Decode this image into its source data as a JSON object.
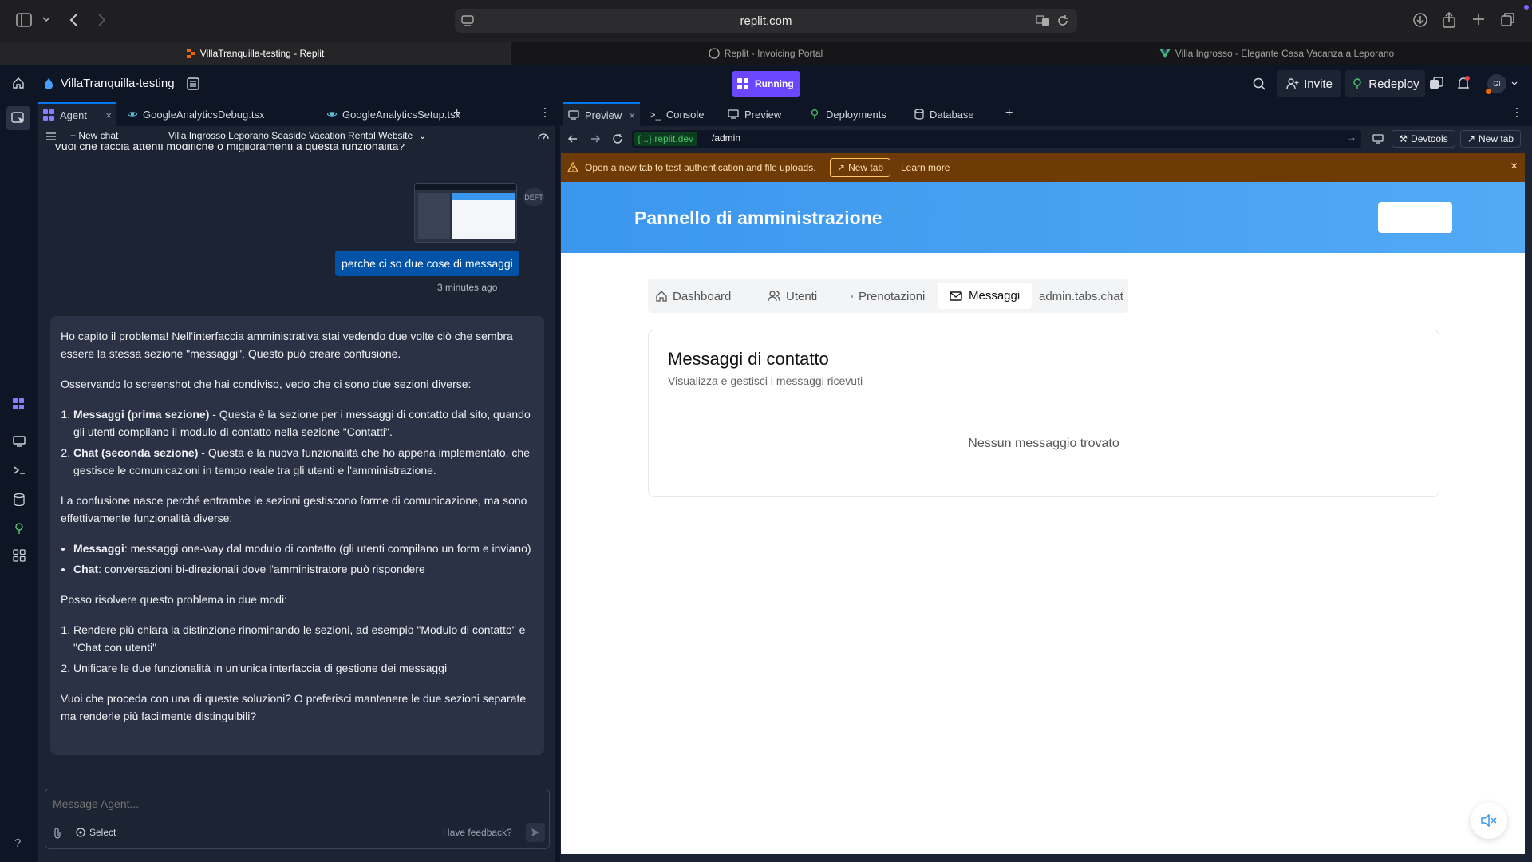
{
  "browser": {
    "url": "replit.com",
    "tabs": [
      {
        "label": "VillaTranquilla-testing - Replit",
        "active": true
      },
      {
        "label": "Replit - Invoicing Portal",
        "active": false
      },
      {
        "label": "Villa Ingrosso - Elegante Casa Vacanza a Leporano",
        "active": false
      }
    ]
  },
  "header": {
    "project_name": "VillaTranquilla-testing",
    "run_status": "Running",
    "invite_label": "Invite",
    "redeploy_label": "Redeploy",
    "avatar_initials": "GI"
  },
  "agent_panel": {
    "tabs": [
      "Agent",
      "GoogleAnalyticsDebug.tsx",
      "GoogleAnalyticsSetup.tsx"
    ],
    "new_chat_label": "New chat",
    "chat_title": "Villa Ingrosso Leporano Seaside Vacation Rental Website",
    "truncated_line": "Vuoi che faccia attenti modifiche o miglioramenti a questa funzionalità?",
    "user_badge": "DEFT",
    "user_message": "perche ci so due cose di messaggi",
    "user_time": "3 minutes ago",
    "agent_message": {
      "p1": "Ho capito il problema! Nell'interfaccia amministrativa stai vedendo due volte ciò che sembra essere la stessa sezione \"messaggi\". Questo può creare confusione.",
      "p2": "Osservando lo screenshot che hai condiviso, vedo che ci sono due sezioni diverse:",
      "list1": [
        {
          "bold": "Messaggi (prima sezione)",
          "text": " - Questa è la sezione per i messaggi di contatto dal sito, quando gli utenti compilano il modulo di contatto nella sezione \"Contatti\"."
        },
        {
          "bold": "Chat (seconda sezione)",
          "text": " - Questa è la nuova funzionalità che ho appena implementato, che gestisce le comunicazioni in tempo reale tra gli utenti e l'amministrazione."
        }
      ],
      "p3": "La confusione nasce perché entrambe le sezioni gestiscono forme di comunicazione, ma sono effettivamente funzionalità diverse:",
      "list2": [
        {
          "bold": "Messaggi",
          "text": ": messaggi one-way dal modulo di contatto (gli utenti compilano un form e inviano)"
        },
        {
          "bold": "Chat",
          "text": ": conversazioni bi-direzionali dove l'amministratore può rispondere"
        }
      ],
      "p4": "Posso risolvere questo problema in due modi:",
      "list3": [
        "Rendere più chiara la distinzione rinominando le sezioni, ad esempio \"Modulo di contatto\" e \"Chat con utenti\"",
        "Unificare le due funzionalità in un'unica interfaccia di gestione dei messaggi"
      ],
      "p5": "Vuoi che proceda con una di queste soluzioni? O preferisci mantenere le due sezioni separate ma renderle più facilmente distinguibili?"
    },
    "composer_placeholder": "Message Agent...",
    "select_label": "Select",
    "feedback_label": "Have feedback?"
  },
  "preview_panel": {
    "tabs": [
      "Preview",
      "Console",
      "Preview",
      "Deployments",
      "Database"
    ],
    "domain": "{...}.replit.dev",
    "path": "/admin",
    "devtools_label": "Devtools",
    "new_tab_label": "New tab",
    "warning_text": "Open a new tab to test authentication and file uploads.",
    "warning_button": "New tab",
    "warning_link": "Learn more"
  },
  "site": {
    "header_title": "Pannello di amministrazione",
    "tabs": [
      "Dashboard",
      "Utenti",
      "Prenotazioni",
      "Messaggi",
      "admin.tabs.chat"
    ],
    "active_tab": "Messaggi",
    "card_title": "Messaggi di contatto",
    "card_subtitle": "Visualizza e gestisci i messaggi ricevuti",
    "empty_text": "Nessun messaggio trovato"
  },
  "colors": {
    "replit_bg": "#0e1525",
    "panel_bg": "#1c2333",
    "message_bg": "#2b3245",
    "user_bubble": "#0053a6",
    "running": "#6b48ff",
    "warning_bg": "#6e3a06",
    "site_header": "#3b97ee"
  }
}
